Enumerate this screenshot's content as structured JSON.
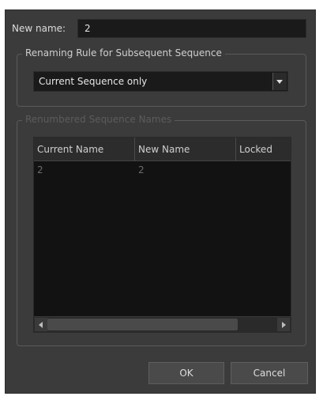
{
  "name_row": {
    "label": "New name:",
    "value": "2"
  },
  "rule_group": {
    "title": "Renaming Rule for Subsequent Sequence",
    "selected": "Current Sequence only"
  },
  "names_group": {
    "title": "Renumbered Sequence Names",
    "columns": [
      "Current Name",
      "New Name",
      "Locked"
    ],
    "rows": [
      {
        "current": "2",
        "new": "2",
        "locked": ""
      }
    ]
  },
  "buttons": {
    "ok": "OK",
    "cancel": "Cancel"
  },
  "icons": {
    "dropdown": "chevron-down-icon",
    "scroll_left": "arrow-left-icon",
    "scroll_right": "arrow-right-icon"
  }
}
